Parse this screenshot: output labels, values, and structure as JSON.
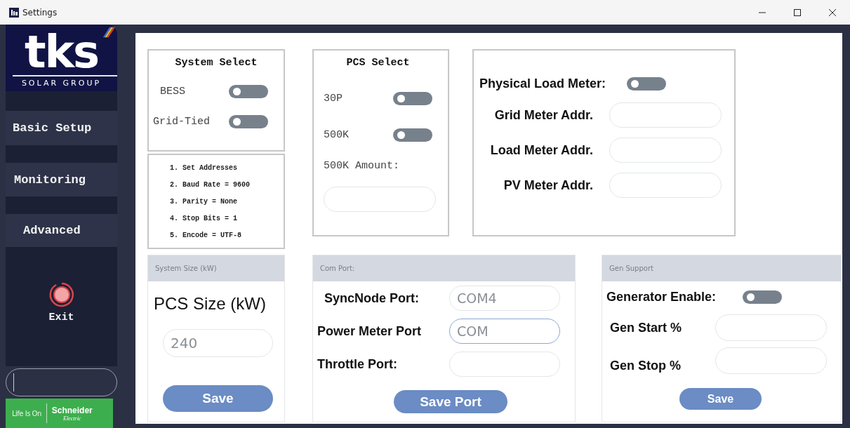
{
  "window": {
    "title": "Settings"
  },
  "logo": {
    "wordmark": "tks",
    "tagline": "SOLAR GROUP"
  },
  "sidebar": {
    "items": [
      "Basic Setup",
      "Monitoring",
      "Advanced"
    ],
    "exit": "Exit"
  },
  "partner_logo": {
    "slogan": "Life Is On",
    "brand": "Schneider",
    "sub": "Electric"
  },
  "system_select": {
    "title": "System Select",
    "toggles": [
      {
        "label": "BESS",
        "on": false
      },
      {
        "label": "Grid-Tied",
        "on": false
      }
    ]
  },
  "instructions": [
    "1. Set Addresses",
    "2. Baud Rate = 9600",
    "3. Parity = None",
    "4. Stop Bits = 1",
    "5. Encode = UTF-8"
  ],
  "pcs_select": {
    "title": "PCS Select",
    "toggles": [
      {
        "label": "30P",
        "on": false
      },
      {
        "label": "500K",
        "on": false
      }
    ],
    "amount_label": "500K Amount:"
  },
  "meters": {
    "toggle": {
      "label": "Physical Load Meter:",
      "on": false
    },
    "fields": [
      {
        "label": "Grid Meter Addr."
      },
      {
        "label": "Load Meter Addr."
      },
      {
        "label": "PV Meter Addr."
      }
    ]
  },
  "system_size": {
    "header": "System Size (kW)",
    "label": "PCS Size (kW)",
    "value": "240",
    "button": "Save"
  },
  "com_port": {
    "header": "Com Port:",
    "fields": [
      {
        "label": "SyncNode Port:",
        "value": "COM4",
        "focused": false
      },
      {
        "label": "Power Meter Port",
        "value": "COM",
        "focused": true
      },
      {
        "label": "Throttle Port:",
        "focused": false
      }
    ],
    "button": "Save Port"
  },
  "gen_support": {
    "header": "Gen Support",
    "toggle": {
      "label": "Generator Enable:",
      "on": false
    },
    "fields": [
      {
        "label": "Gen Start %"
      },
      {
        "label": "Gen Stop %"
      }
    ],
    "button": "Save"
  }
}
